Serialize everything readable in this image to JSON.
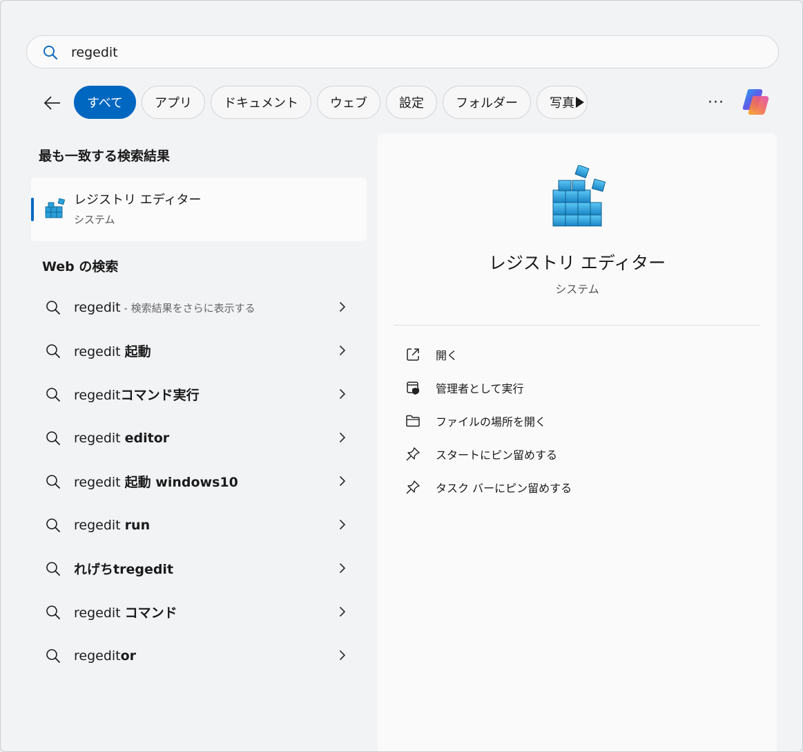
{
  "search": {
    "value": "regedit",
    "placeholder": ""
  },
  "filters": {
    "back_icon": "arrow-left-icon",
    "chips": [
      {
        "label": "すべて",
        "active": true
      },
      {
        "label": "アプリ",
        "active": false
      },
      {
        "label": "ドキュメント",
        "active": false
      },
      {
        "label": "ウェブ",
        "active": false
      },
      {
        "label": "設定",
        "active": false
      },
      {
        "label": "フォルダー",
        "active": false
      },
      {
        "label": "写真",
        "active": false
      }
    ],
    "more_label": "···"
  },
  "best_match": {
    "heading": "最も一致する検索結果",
    "name": "レジストリ エディター",
    "type": "システム"
  },
  "web": {
    "heading": "Web の検索",
    "items": [
      {
        "query": "regedit",
        "bold": "",
        "suffix": " - 検索結果をさらに表示する"
      },
      {
        "query": "regedit ",
        "bold": "起動",
        "suffix": ""
      },
      {
        "query": "regedit",
        "bold": "コマンド実行",
        "suffix": ""
      },
      {
        "query": "regedit ",
        "bold": "editor",
        "suffix": ""
      },
      {
        "query": "regedit ",
        "bold": "起動 windows10",
        "suffix": ""
      },
      {
        "query": "regedit ",
        "bold": "run",
        "suffix": ""
      },
      {
        "query": "",
        "bold": "れげちtregedit",
        "suffix": ""
      },
      {
        "query": "regedit ",
        "bold": "コマンド",
        "suffix": ""
      },
      {
        "query": "regedit",
        "bold": "or",
        "suffix": ""
      }
    ]
  },
  "preview": {
    "name": "レジストリ エディター",
    "type": "システム",
    "actions": [
      {
        "label": "開く",
        "icon": "open-external-icon"
      },
      {
        "label": "管理者として実行",
        "icon": "shield-admin-icon"
      },
      {
        "label": "ファイルの場所を開く",
        "icon": "folder-icon"
      },
      {
        "label": "スタートにピン留めする",
        "icon": "pin-icon"
      },
      {
        "label": "タスク バーにピン留めする",
        "icon": "pin-icon"
      }
    ]
  },
  "colors": {
    "accent": "#0067c0",
    "registry_blue": "#2a9fd8"
  }
}
